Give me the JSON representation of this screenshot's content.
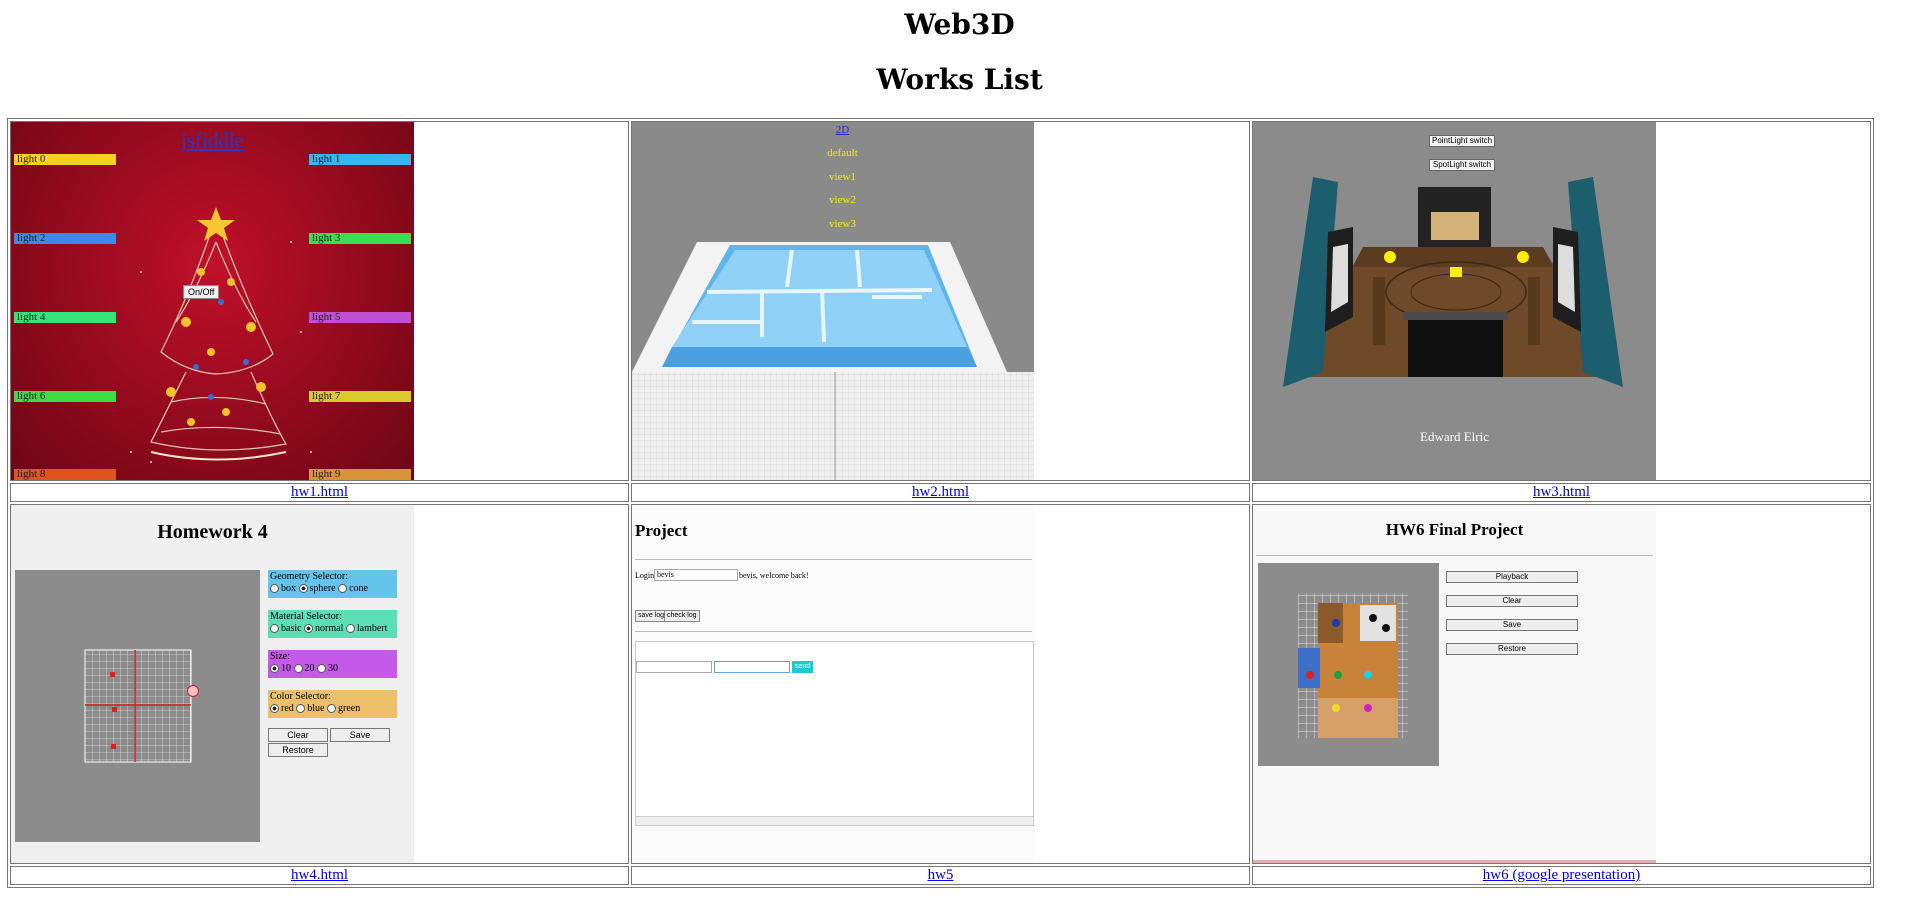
{
  "page": {
    "title": "Web3D",
    "subtitle": "Works List"
  },
  "works": [
    {
      "link": "hw1.html",
      "jsfiddle": "jsfiddle",
      "lights": [
        "light 0",
        "light 1",
        "light 2",
        "light 3",
        "light 4",
        "light 5",
        "light 6",
        "light 7",
        "light 8",
        "light 9"
      ],
      "onoff": "On/Off"
    },
    {
      "link": "hw2.html",
      "views": [
        "2D",
        "default",
        "view1",
        "view2",
        "view3"
      ]
    },
    {
      "link": "hw3.html",
      "buttons": [
        "PointLight switch",
        "SpotLight switch"
      ],
      "caption": "Edward Elric"
    },
    {
      "link": "hw4.html",
      "title": "Homework 4",
      "geometry": {
        "label": "Geometry Selector:",
        "options": [
          "box",
          "sphere",
          "cone"
        ]
      },
      "material": {
        "label": "Material Selector:",
        "options": [
          "basic",
          "normal",
          "lambert"
        ]
      },
      "size": {
        "label": "Size:",
        "options": [
          "10",
          "20",
          "30"
        ]
      },
      "color": {
        "label": "Color Selector:",
        "options": [
          "red",
          "blue",
          "green"
        ]
      },
      "buttons": {
        "clear": "Clear",
        "save": "Save",
        "restore": "Restore"
      }
    },
    {
      "link": "hw5",
      "title": "Project",
      "login_label": "Login:",
      "login_value": "bevis",
      "welcome": "bevis, welcome back!",
      "save_log": "save log",
      "check_log": "check log",
      "send": "send"
    },
    {
      "link": "hw6 (google presentation)",
      "title": "HW6 Final Project",
      "buttons": [
        "Playback",
        "Clear",
        "Save",
        "Restore"
      ]
    }
  ],
  "colors": {
    "light_bars": [
      "#f2d21e",
      "#38b6ee",
      "#3a8be8",
      "#3cdc55",
      "#38e47a",
      "#c04fd2",
      "#3ddc45",
      "#d9c92a",
      "#e0521e",
      "#d99438"
    ],
    "link": "#0000ee"
  }
}
